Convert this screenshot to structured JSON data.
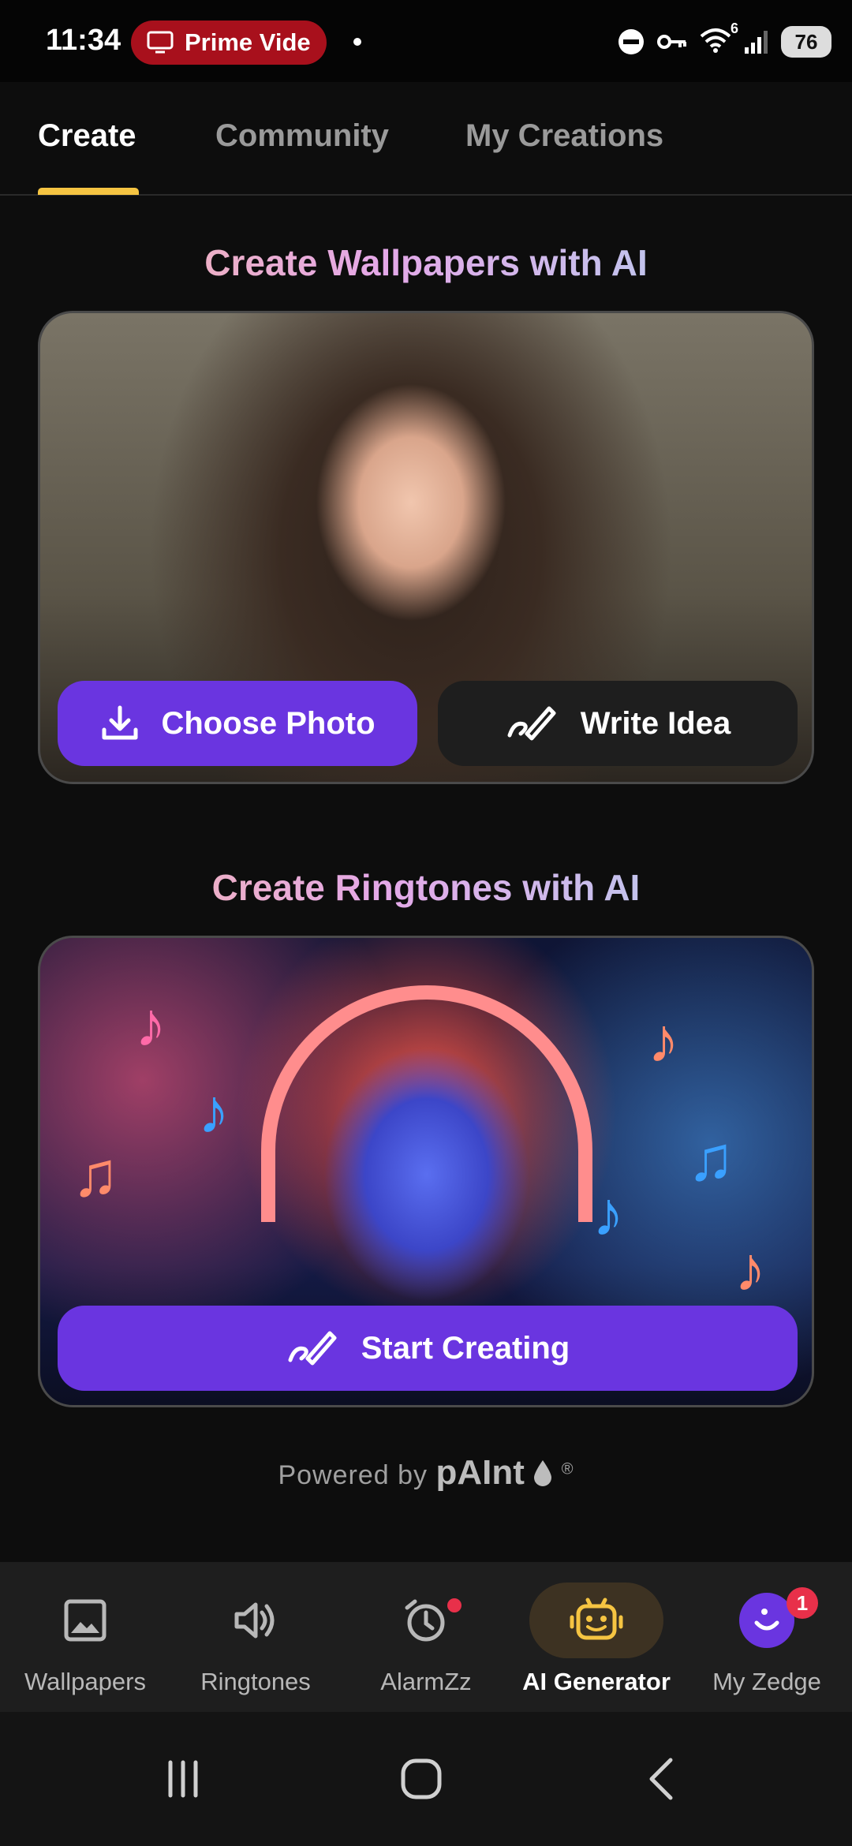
{
  "status_bar": {
    "time": "11:34",
    "media_pill_label": "Prime Vide",
    "wifi_superscript": "6",
    "battery_percent": "76"
  },
  "tabs": [
    {
      "label": "Create",
      "active": true
    },
    {
      "label": "Community",
      "active": false
    },
    {
      "label": "My Creations",
      "active": false
    }
  ],
  "wallpaper_section": {
    "title": "Create Wallpapers with AI",
    "choose_photo_label": "Choose Photo",
    "write_idea_label": "Write Idea"
  },
  "ringtone_section": {
    "title": "Create Ringtones with AI",
    "start_creating_label": "Start Creating"
  },
  "powered_by": {
    "prefix": "Powered by",
    "brand": "pAInt",
    "mark": "®"
  },
  "bottom_nav": [
    {
      "label": "Wallpapers",
      "icon": "image-icon",
      "active": false
    },
    {
      "label": "Ringtones",
      "icon": "speaker-icon",
      "active": false
    },
    {
      "label": "AlarmZz",
      "icon": "alarm-clock-icon",
      "active": false
    },
    {
      "label": "AI Generator",
      "icon": "robot-face-icon",
      "active": true
    },
    {
      "label": "My Zedge",
      "icon": "profile-avatar-icon",
      "active": false,
      "badge": "1"
    }
  ],
  "colors": {
    "accent_purple": "#6a35e0",
    "tab_underline": "#f5c442",
    "badge_red": "#e8304a"
  }
}
